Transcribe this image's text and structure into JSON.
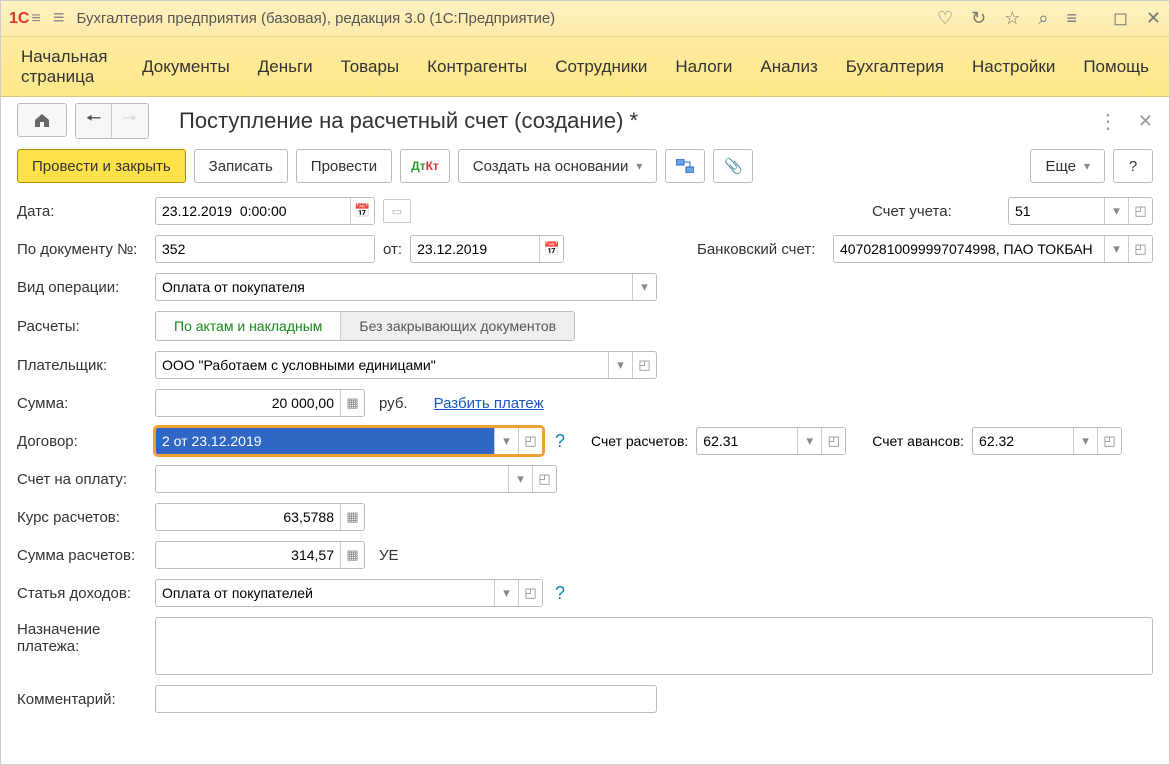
{
  "titlebar": {
    "title": "Бухгалтерия предприятия (базовая), редакция 3.0  (1С:Предприятие)"
  },
  "mainmenu": {
    "items": [
      "Начальная страница",
      "Документы",
      "Деньги",
      "Товары",
      "Контрагенты",
      "Сотрудники",
      "Налоги",
      "Анализ",
      "Бухгалтерия",
      "Настройки",
      "Помощь"
    ]
  },
  "doc": {
    "title": "Поступление на расчетный счет (создание) *"
  },
  "cmdbar": {
    "post_close": "Провести и закрыть",
    "save": "Записать",
    "post": "Провести",
    "create_based": "Создать на основании",
    "more": "Еще",
    "help": "?"
  },
  "labels": {
    "date": "Дата:",
    "account": "Счет учета:",
    "doc_no": "По документу №:",
    "from": "от:",
    "bank_acct": "Банковский счет:",
    "op_type": "Вид операции:",
    "settlements": "Расчеты:",
    "by_acts": "По актам и накладным",
    "no_closing": "Без закрывающих документов",
    "payer": "Плательщик:",
    "sum": "Сумма:",
    "rub": "руб.",
    "split": "Разбить платеж",
    "contract": "Договор:",
    "settle_acct": "Счет расчетов:",
    "advance_acct": "Счет авансов:",
    "invoice": "Счет на оплату:",
    "rate": "Курс расчетов:",
    "settle_sum": "Сумма расчетов:",
    "ue": "УЕ",
    "income_item": "Статья доходов:",
    "purpose": "Назначение платежа:",
    "comment": "Комментарий:"
  },
  "values": {
    "date": "23.12.2019  0:00:00",
    "account": "51",
    "doc_no": "352",
    "doc_date": "23.12.2019",
    "bank_acct": "40702810099997074998, ПАО ТОКБАН",
    "op_type": "Оплата от покупателя",
    "payer": "ООО \"Работаем с условными единицами\"",
    "sum": "20 000,00",
    "contract": "2 от 23.12.2019",
    "settle_acct": "62.31",
    "advance_acct": "62.32",
    "invoice": "",
    "rate": "63,5788",
    "settle_sum": "314,57",
    "income_item": "Оплата от покупателей",
    "purpose": "",
    "comment": ""
  }
}
